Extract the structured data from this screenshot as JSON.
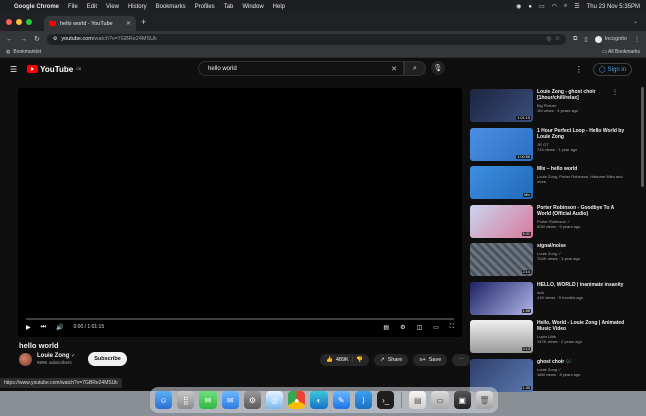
{
  "menubar": {
    "app_name": "Google Chrome",
    "items": [
      "File",
      "Edit",
      "View",
      "History",
      "Bookmarks",
      "Profiles",
      "Tab",
      "Window",
      "Help"
    ],
    "datetime": "Thu 23 Nov 5:35PM"
  },
  "browser": {
    "tab_title": "hello world - YouTube",
    "url_host": "youtube.com",
    "url_path": "/watch?v=7GBRe24MSUk",
    "profile_label": "Incognito",
    "bookmarks_label": "Bookmarklet",
    "all_bookmarks_label": "All Bookmarks",
    "status_url": "https://www.youtube.com/watch?v=7GBRe24MSUk"
  },
  "youtube": {
    "logo_text": "YouTube",
    "logo_region": "GB",
    "search_value": "hello world",
    "sign_in_label": "Sign in"
  },
  "player": {
    "time": "0:00 / 1:01:15",
    "progress": 0
  },
  "video": {
    "title": "hello world",
    "channel": "Louie Zong",
    "subscribers": "999K subscribers",
    "subscribe_label": "Subscribe",
    "likes": "489K",
    "share_label": "Share",
    "save_label": "Save"
  },
  "recommendations": [
    {
      "title": "Louie Zong - ghost choir [1hour/chill/relax]",
      "channel": "Big Picture",
      "meta": "1M views · 4 years ago",
      "duration": "1:01:15",
      "color": "#2b3a5c"
    },
    {
      "title": "1 Hour Perfect Loop - Hello World by Louie Zong",
      "channel": "JR GT",
      "meta": "716 views · 1 year ago",
      "duration": "1:00:56",
      "color": "#3d7fd3"
    },
    {
      "title": "Mix – hello world",
      "channel": "Louie Zong, Porter Robinson, Hatsune Miku and more",
      "meta": "",
      "duration": "Mix",
      "color": "#2f80d0"
    },
    {
      "title": "Porter Robinson - Goodbye To A World (Official Audio)",
      "channel": "Porter Robinson ✓",
      "meta": "62M views · 9 years ago",
      "duration": "5:31",
      "color": "#b9c7e8"
    },
    {
      "title": "signal/noise",
      "channel": "Louie Zong ✓",
      "meta": "704K views · 1 year ago",
      "duration": "2:14",
      "color": "#5c6670"
    },
    {
      "title": "HELLO, WORLD | inanimate insanity",
      "channel": "nick",
      "meta": "41K views · 9 months ago",
      "duration": "1:56",
      "color": "#2a2f7a"
    },
    {
      "title": "Hello, World - Louie Zong | Animated Music Video",
      "channel": "Lupin Lilith",
      "meta": "147K views · 2 years ago",
      "duration": "2:13",
      "color": "#e8e8e8"
    },
    {
      "title": "ghost choir 🎶",
      "channel": "Louie Zong ✓",
      "meta": "18M views · 8 years ago",
      "duration": "1:30",
      "color": "#3b4f7a"
    }
  ],
  "dock_icons": [
    "finder-icon",
    "launchpad-icon",
    "messages-icon",
    "mail-icon",
    "settings-icon",
    "safari-icon",
    "chrome-icon",
    "edge-icon",
    "xcode-icon",
    "vscode-icon",
    "terminal-icon",
    "preview-icon",
    "disk-icon",
    "screenshot-icon",
    "trash-icon"
  ]
}
